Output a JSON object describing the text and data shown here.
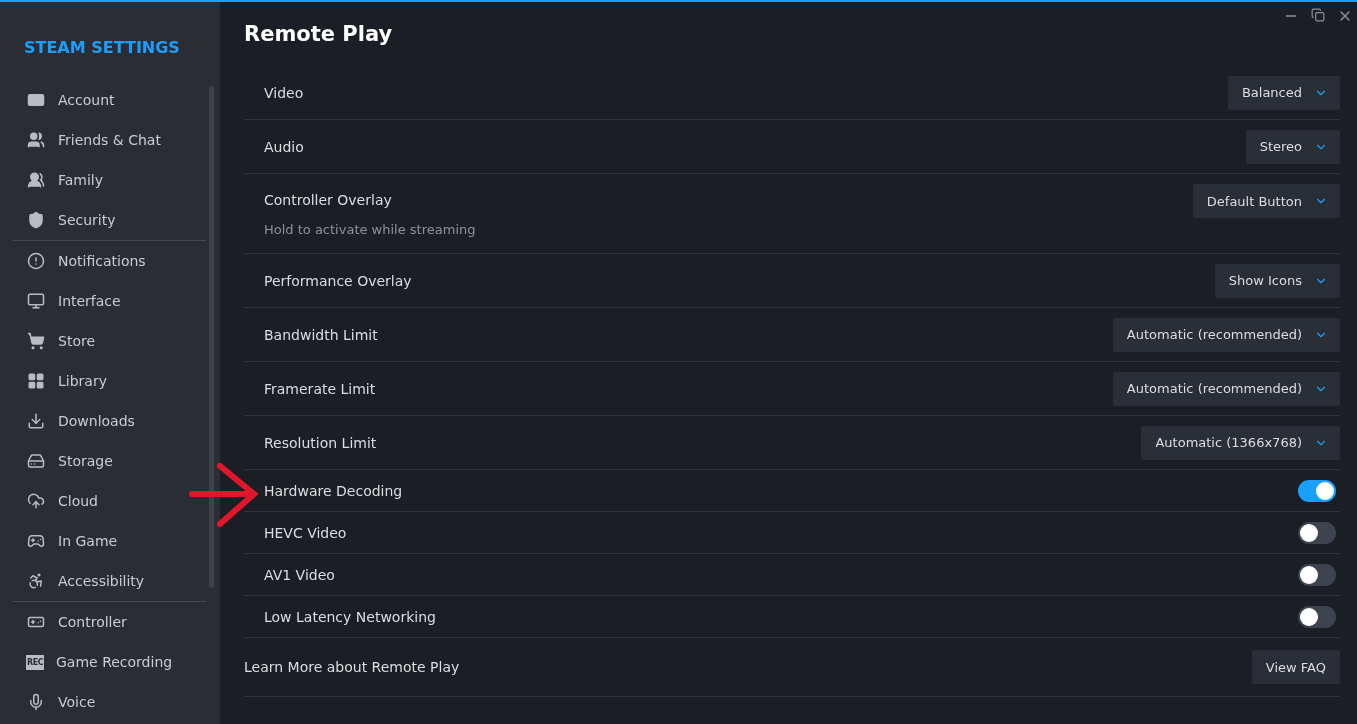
{
  "sidebar": {
    "title": "STEAM SETTINGS",
    "groups": [
      {
        "items": [
          {
            "label": "Account"
          },
          {
            "label": "Friends & Chat"
          },
          {
            "label": "Family"
          },
          {
            "label": "Security"
          }
        ]
      },
      {
        "items": [
          {
            "label": "Notifications"
          },
          {
            "label": "Interface"
          },
          {
            "label": "Store"
          },
          {
            "label": "Library"
          },
          {
            "label": "Downloads"
          },
          {
            "label": "Storage"
          },
          {
            "label": "Cloud"
          },
          {
            "label": "In Game"
          },
          {
            "label": "Accessibility"
          }
        ]
      },
      {
        "items": [
          {
            "label": "Controller"
          },
          {
            "label": "Game Recording",
            "badge": "REC"
          },
          {
            "label": "Voice"
          }
        ]
      }
    ]
  },
  "page": {
    "title": "Remote Play",
    "settings": [
      {
        "kind": "dropdown",
        "label": "Video",
        "value": "Balanced"
      },
      {
        "kind": "dropdown",
        "label": "Audio",
        "value": "Stereo"
      },
      {
        "kind": "dropdown",
        "label": "Controller Overlay",
        "value": "Default Button",
        "description": "Hold to activate while streaming"
      },
      {
        "kind": "dropdown",
        "label": "Performance Overlay",
        "value": "Show Icons"
      },
      {
        "kind": "dropdown",
        "label": "Bandwidth Limit",
        "value": "Automatic (recommended)"
      },
      {
        "kind": "dropdown",
        "label": "Framerate Limit",
        "value": "Automatic (recommended)"
      },
      {
        "kind": "dropdown",
        "label": "Resolution Limit",
        "value": "Automatic (1366x768)"
      },
      {
        "kind": "toggle",
        "label": "Hardware Decoding",
        "on": true
      },
      {
        "kind": "toggle",
        "label": "HEVC Video",
        "on": false
      },
      {
        "kind": "toggle",
        "label": "AV1 Video",
        "on": false
      },
      {
        "kind": "toggle",
        "label": "Low Latency Networking",
        "on": false
      }
    ],
    "footer": {
      "label": "Learn More about Remote Play",
      "button": "View FAQ"
    }
  }
}
